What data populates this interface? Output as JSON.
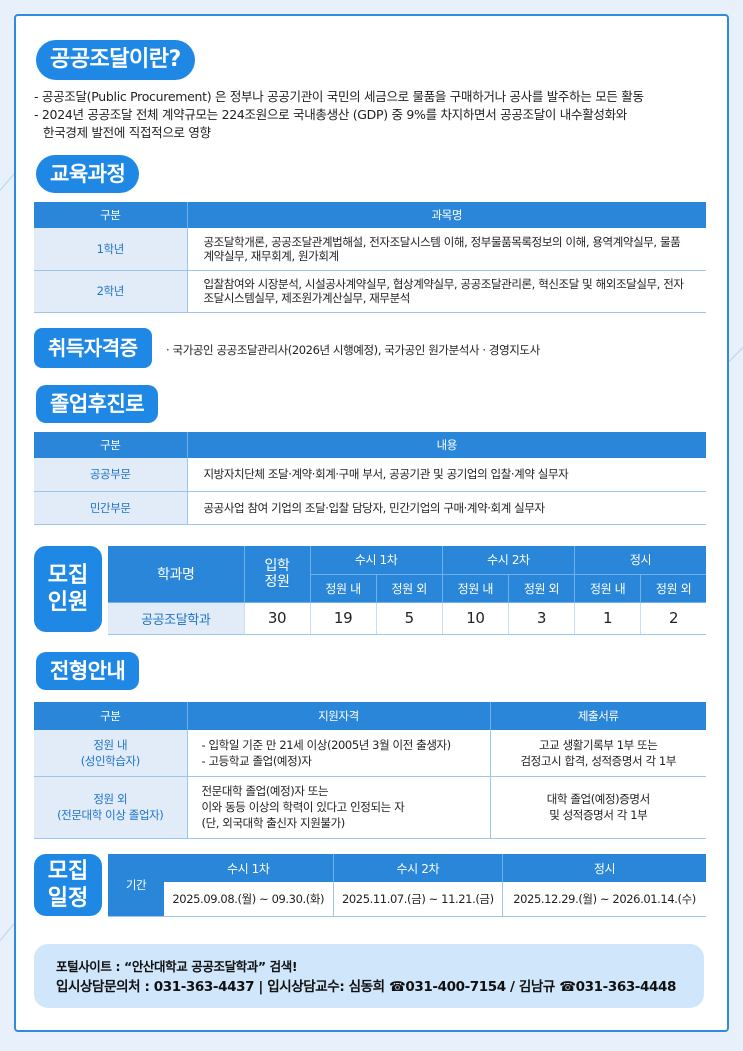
{
  "intro": {
    "title": "공공조달이란?",
    "lines": [
      "- 공공조달(Public Procurement) 은 정부나 공공기관이 국민의 세금으로 물품을 구매하거나 공사를 발주하는 모든 활동",
      "- 2024년 공공조달 전체 계약규모는 224조원으로 국내총생산 (GDP) 중 9%를 차지하면서 공공조달이 내수활성화와",
      "  한국경제 발전에 직접적으로 영향"
    ]
  },
  "curriculum": {
    "title": "교육과정",
    "headers": [
      "구분",
      "과목명"
    ],
    "rows": [
      {
        "label": "1학년",
        "text": "공조달학개론, 공공조달관계법해설, 전자조달시스템 이해, 정부물품목록정보의 이해, 용역계약실무, 물품계약실무, 재무회계, 원가회계"
      },
      {
        "label": "2학년",
        "text": "입찰참여와 시장분석, 시설공사계약실무, 협상계약실무, 공공조달관리론, 혁신조달 및 해외조달실무, 전자조달시스템실무, 제조원가계산실무, 재무분석"
      }
    ]
  },
  "certificates": {
    "title": "취득자격증",
    "text": "· 국가공인 공공조달관리사(2026년 시행예정), 국가공인 원가분석사 · 경영지도사"
  },
  "career": {
    "title": "졸업후진로",
    "headers": [
      "구분",
      "내용"
    ],
    "rows": [
      {
        "label": "공공부문",
        "text": "지방자치단체 조달·계약·회계·구매 부서, 공공기관 및 공기업의 입찰·계약 실무자"
      },
      {
        "label": "민간부문",
        "text": "공공사업 참여 기업의 조달·입찰 담당자, 민간기업의 구매·계약·회계 실무자"
      }
    ]
  },
  "recruit_count": {
    "label_1": "모집",
    "label_2": "인원",
    "h_dept": "학과명",
    "h_quota": "입학\n정원",
    "h_s1": "수시 1차",
    "h_s2": "수시 2차",
    "h_reg": "정시",
    "h_in": "정원 내",
    "h_out": "정원 외",
    "dept": "공공조달학과",
    "quota": "30",
    "s1_in": "19",
    "s1_out": "5",
    "s2_in": "10",
    "s2_out": "3",
    "reg_in": "1",
    "reg_out": "2"
  },
  "guide": {
    "title": "전형안내",
    "headers": [
      "구분",
      "지원자격",
      "제출서류"
    ],
    "rows": [
      {
        "label_1": "정원 내",
        "label_2": "(성인학습자)",
        "qual": [
          "- 입학일 기준 만 21세 이상(2005년 3월 이전 출생자)",
          "- 고등학교 졸업(예정)자"
        ],
        "docs": [
          "고교 생활기록부 1부 또는",
          "검정고시 합격, 성적증명서 각 1부"
        ]
      },
      {
        "label_1": "정원 외",
        "label_2": "(전문대학 이상 졸업자)",
        "qual": [
          "전문대학 졸업(예정)자 또는",
          "이와 동등 이상의 학력이 있다고 인정되는 자",
          "(단, 외국대학 출신자 지원불가)"
        ],
        "docs": [
          "대학 졸업(예정)증명서",
          "및 성적증명서 각 1부"
        ]
      }
    ]
  },
  "schedule": {
    "label_1": "모집",
    "label_2": "일정",
    "period": "기간",
    "headers": [
      "수시 1차",
      "수시 2차",
      "정시"
    ],
    "dates": [
      "2025.09.08.(월) ~ 09.30.(화)",
      "2025.11.07.(금) ~ 11.21.(금)",
      "2025.12.29.(월) ~ 2026.01.14.(수)"
    ]
  },
  "footer": {
    "line1": "포털사이트 : “안산대학교 공공조달학과” 검색!",
    "line2": "입시상담문의처 : 031-363-4437 | 입시상담교수: 심동희 ☎031-400-7154 / 김남규 ☎031-363-4448"
  },
  "colors": {
    "accent": "#1f88e5",
    "label_bg": "#e2ecf8",
    "footer_bg": "#cfe6fb"
  }
}
